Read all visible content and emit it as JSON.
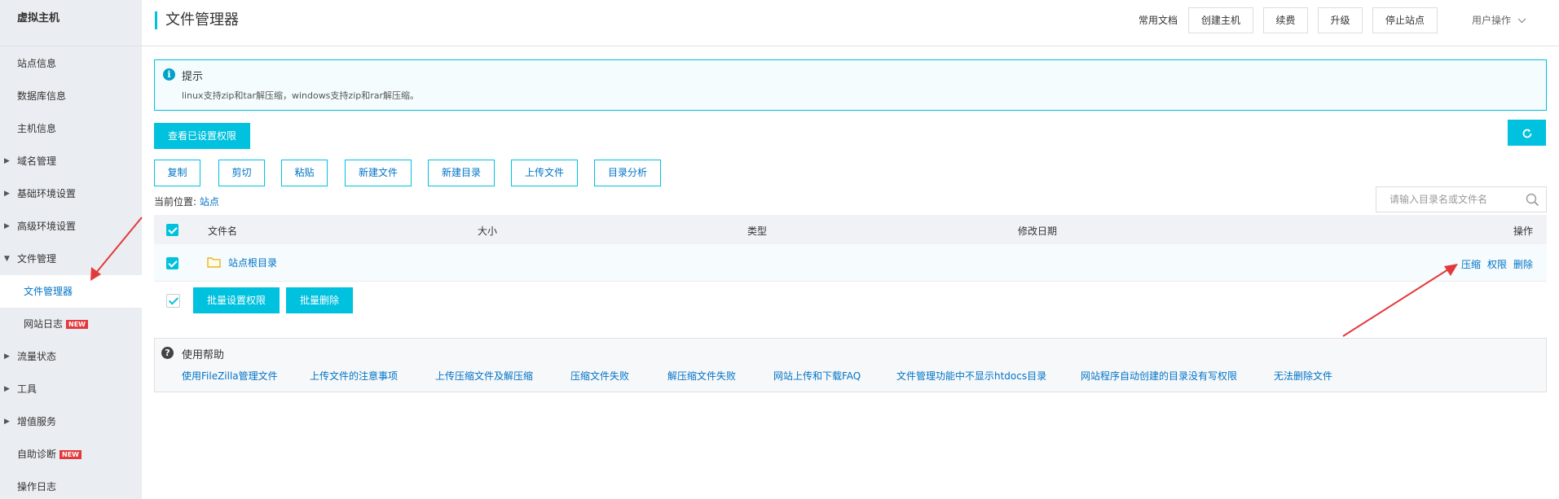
{
  "sidebar": {
    "title": "虚拟主机",
    "items": [
      {
        "label": "站点信息"
      },
      {
        "label": "数据库信息"
      },
      {
        "label": "主机信息"
      },
      {
        "label": "域名管理"
      },
      {
        "label": "基础环境设置"
      },
      {
        "label": "高级环境设置"
      },
      {
        "label": "文件管理"
      },
      {
        "label": "文件管理器"
      },
      {
        "label": "网站日志",
        "badge": "NEW"
      },
      {
        "label": "流量状态"
      },
      {
        "label": "工具"
      },
      {
        "label": "增值服务"
      },
      {
        "label": "自助诊断",
        "badge": "NEW"
      },
      {
        "label": "操作日志"
      }
    ]
  },
  "header": {
    "title": "文件管理器",
    "docs_link": "常用文档",
    "buttons": {
      "create": "创建主机",
      "renew": "续费",
      "upgrade": "升级",
      "stop": "停止站点"
    },
    "user_menu": "用户操作"
  },
  "tip": {
    "title": "提示",
    "text": "linux支持zip和tar解压缩，windows支持zip和rar解压缩。"
  },
  "actions": {
    "view_permissions": "查看已设置权限",
    "toolbar": {
      "copy": "复制",
      "cut": "剪切",
      "paste": "粘贴",
      "new_file": "新建文件",
      "new_dir": "新建目录",
      "upload": "上传文件",
      "analyze": "目录分析"
    }
  },
  "location": {
    "label": "当前位置:",
    "path": "站点"
  },
  "search": {
    "placeholder": "请输入目录名或文件名"
  },
  "table": {
    "columns": {
      "name": "文件名",
      "size": "大小",
      "type": "类型",
      "modified": "修改日期",
      "operations": "操作"
    },
    "rows": [
      {
        "name": "站点根目录",
        "ops": {
          "compress": "压缩",
          "permission": "权限",
          "delete": "删除"
        }
      }
    ]
  },
  "bulk": {
    "set_permissions": "批量设置权限",
    "delete": "批量删除"
  },
  "help": {
    "title": "使用帮助",
    "links": [
      "使用FileZilla管理文件",
      "上传文件的注意事项",
      "上传压缩文件及解压缩",
      "压缩文件失败",
      "解压缩文件失败",
      "网站上传和下载FAQ",
      "文件管理功能中不显示htdocs目录",
      "网站程序自动创建的目录没有写权限",
      "无法删除文件"
    ]
  },
  "colors": {
    "accent": "#00c1de",
    "link": "#0073c6",
    "annotation_arrow": "#e4393c"
  },
  "icons": [
    "info-icon",
    "refresh-icon",
    "search-icon",
    "folder-icon",
    "help-icon",
    "chevron-down-icon",
    "caret-right-icon",
    "caret-down-icon"
  ]
}
